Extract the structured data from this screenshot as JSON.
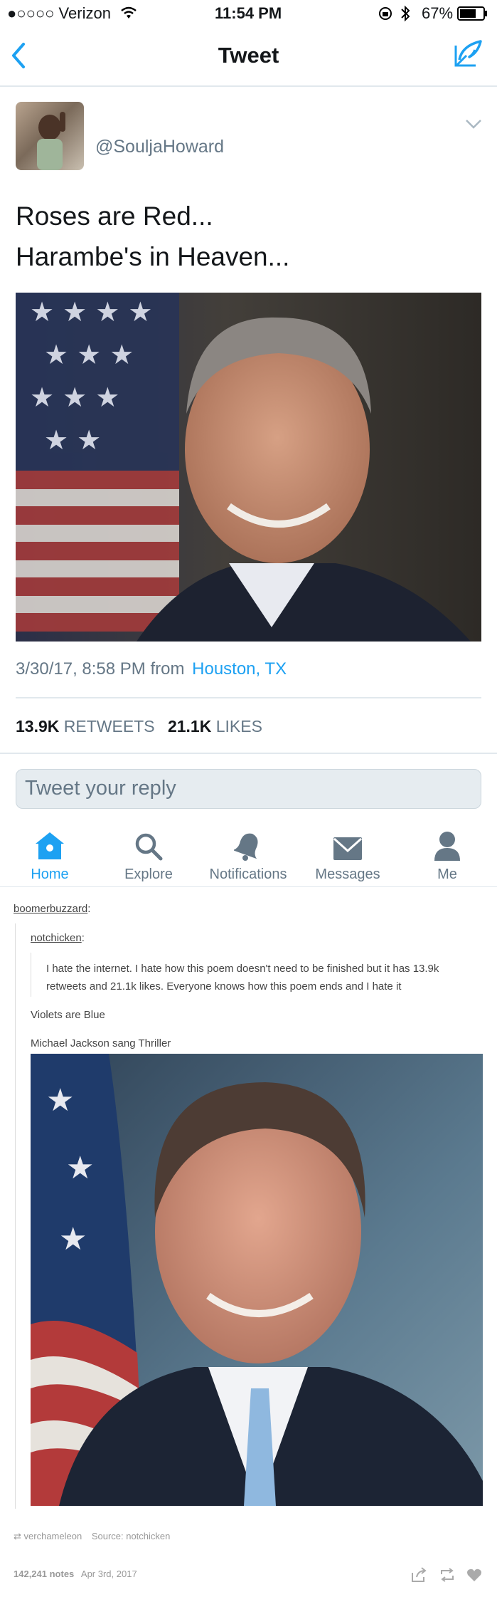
{
  "status_bar": {
    "carrier": "●○○○○ Verizon",
    "time": "11:54 PM",
    "battery": "67%"
  },
  "nav": {
    "title": "Tweet"
  },
  "tweet": {
    "handle": "@SouljaHoward",
    "line1": "Roses are Red...",
    "line2": "Harambe's in Heaven...",
    "date": "3/30/17, 8:58 PM from",
    "location": "Houston, TX",
    "retweets_count": "13.9K",
    "retweets_label": "RETWEETS",
    "likes_count": "21.1K",
    "likes_label": "LIKES",
    "reply_placeholder": "Tweet your reply"
  },
  "tabs": [
    {
      "label": "Home"
    },
    {
      "label": "Explore"
    },
    {
      "label": "Notifications"
    },
    {
      "label": "Messages"
    },
    {
      "label": "Me"
    }
  ],
  "tumblr": {
    "user1": "boomerbuzzard",
    "user2": "notchicken",
    "quote": "I hate the internet. I hate how this poem doesn't need to be finished but it has 13.9k retweets and 21.1k likes. Everyone knows how this poem ends and I hate it",
    "line3": "Violets are Blue",
    "line4": "Michael Jackson sang Thriller",
    "reblogger": "verchameleon",
    "source": "Source: notchicken",
    "notes": "142,241 notes",
    "date": "Apr 3rd, 2017"
  },
  "colors": {
    "accent": "#1da1f2",
    "muted": "#657786",
    "divider": "#e1e8ed"
  }
}
